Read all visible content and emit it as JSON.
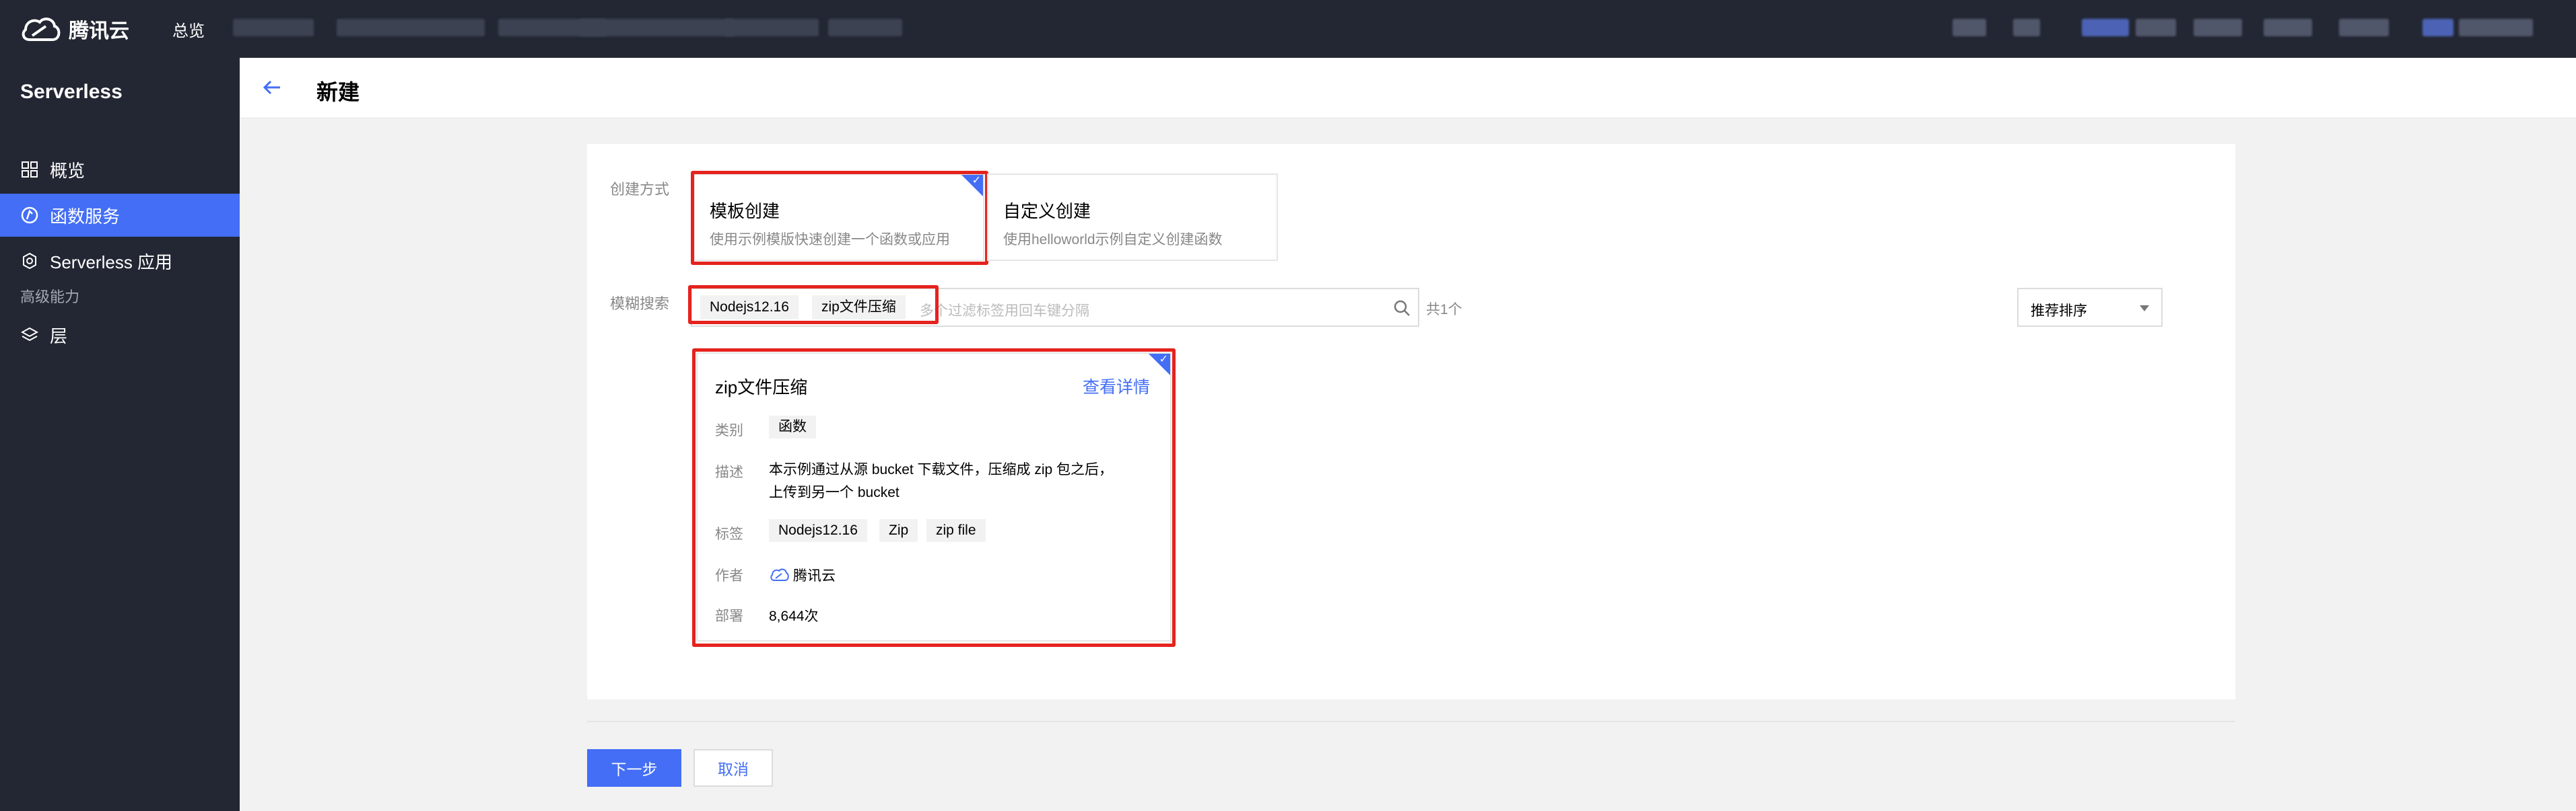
{
  "topbar": {
    "logo_text": "腾讯云",
    "nav_overview": "总览"
  },
  "sidebar": {
    "title": "Serverless",
    "items": [
      {
        "label": "概览",
        "icon": "grid-icon"
      },
      {
        "label": "函数服务",
        "icon": "function-icon",
        "active": true
      },
      {
        "label": "Serverless 应用",
        "icon": "gear-icon"
      }
    ],
    "group_label": "高级能力",
    "group_items": [
      {
        "label": "层",
        "icon": "layers-icon"
      }
    ]
  },
  "header": {
    "title": "新建"
  },
  "form": {
    "create_method_label": "创建方式",
    "options": [
      {
        "title": "模板创建",
        "desc": "使用示例模版快速创建一个函数或应用",
        "selected": true
      },
      {
        "title": "自定义创建",
        "desc": "使用helloworld示例自定义创建函数",
        "selected": false
      }
    ],
    "search_label": "模糊搜索",
    "search_tags": [
      "Nodejs12.16",
      "zip文件压缩"
    ],
    "search_placeholder": "多个过滤标签用回车键分隔",
    "result_count": "共1个",
    "sort_value": "推荐排序"
  },
  "template_card": {
    "title": "zip文件压缩",
    "detail_link": "查看详情",
    "category_label": "类别",
    "category_value": "函数",
    "desc_label": "描述",
    "desc_value": "本示例通过从源 bucket 下载文件，压缩成 zip 包之后，上传到另一个 bucket",
    "tags_label": "标签",
    "tags": [
      "Nodejs12.16",
      "Zip",
      "zip file"
    ],
    "author_label": "作者",
    "author_value": "腾讯云",
    "deploy_label": "部署",
    "deploy_value": "8,644次"
  },
  "footer": {
    "next_label": "下一步",
    "cancel_label": "取消"
  },
  "colors": {
    "accent": "#436ef5",
    "sidebar_bg": "#232733",
    "highlight_red": "#e5231e"
  }
}
